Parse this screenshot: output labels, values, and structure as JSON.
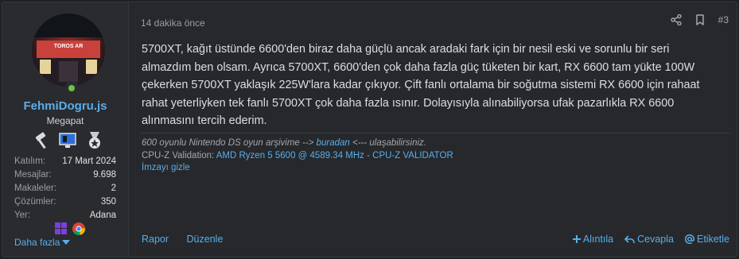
{
  "user": {
    "name": "FehmiDogru.js",
    "title": "Megapat",
    "avatar_sign": "TOROS AR",
    "stats": [
      {
        "label": "Katılım:",
        "value": "17 Mart 2024"
      },
      {
        "label": "Mesajlar:",
        "value": "9.698"
      },
      {
        "label": "Makaleler:",
        "value": "2"
      },
      {
        "label": "Çözümler:",
        "value": "350"
      },
      {
        "label": "Yer:",
        "value": "Adana"
      }
    ],
    "more_label": "Daha fazla"
  },
  "post": {
    "time": "14 dakika önce",
    "number": "#3",
    "body": "5700XT, kağıt üstünde 6600'den biraz daha güçlü ancak aradaki fark için bir nesil eski ve sorunlu bir seri almazdım ben olsam. Ayrıca 5700XT, 6600'den çok daha fazla güç tüketen bir kart, RX 6600 tam yükte 100W çekerken 5700XT yaklaşık 225W'lara kadar çıkıyor. Çift fanlı ortalama bir soğutma sistemi RX 6600 için rahaat rahat yeterliyken tek fanlı 5700XT çok daha fazla ısınır. Dolayısıyla alınabiliyorsa ufak pazarlıkla RX 6600 alınmasını tercih ederim."
  },
  "signature": {
    "line1_pre": "600 oyunlu Nintendo DS oyun arşivime --> ",
    "line1_link": "buradan",
    "line1_post": " <--- ulaşabilirsiniz.",
    "line2_pre": "CPU-Z Validation: ",
    "line2_link": "AMD Ryzen 5 5600 @ 4589.34 MHz - CPU-Z VALIDATOR",
    "hide_label": "İmzayı gizle"
  },
  "footer": {
    "report": "Rapor",
    "edit": "Düzenle",
    "quote": "Alıntıla",
    "reply": "Cevapla",
    "tag": "Etiketle"
  },
  "colors": {
    "link": "#5aaee9",
    "online": "#6cc24a"
  }
}
